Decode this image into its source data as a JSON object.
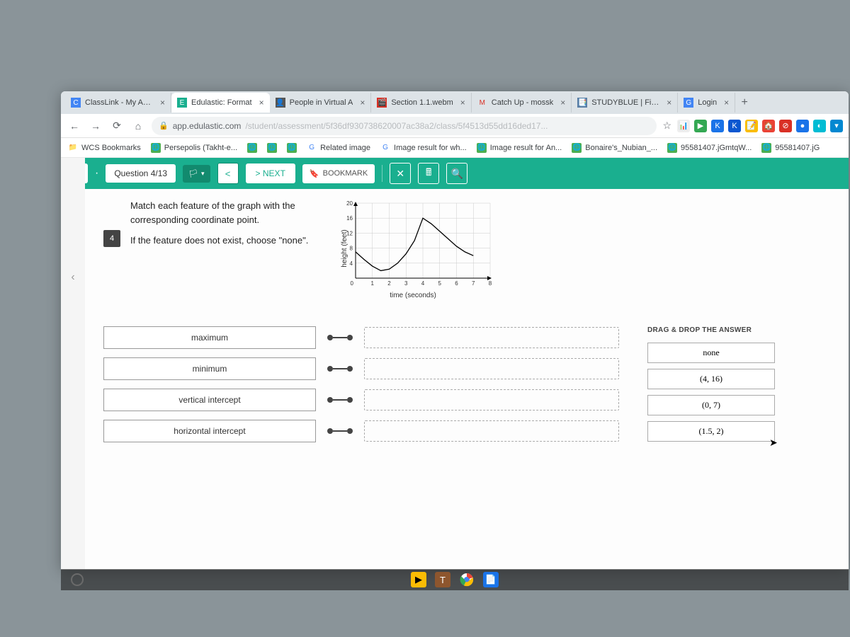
{
  "tabs": [
    {
      "fav_bg": "#4285f4",
      "fav_txt": "C",
      "title": "ClassLink - My Apps"
    },
    {
      "fav_bg": "#1aaf8f",
      "fav_txt": "E",
      "title": "Edulastic: Format"
    },
    {
      "fav_bg": "#555",
      "fav_txt": "👤",
      "title": "People in Virtual A"
    },
    {
      "fav_bg": "#d93025",
      "fav_txt": "🎬",
      "title": "Section 1.1.webm"
    },
    {
      "fav_bg": "#fff",
      "fav_txt": "M",
      "title": "Catch Up - mossk"
    },
    {
      "fav_bg": "#5b7fa6",
      "fav_txt": "📑",
      "title": "STUDYBLUE | Find"
    },
    {
      "fav_bg": "#4285f4",
      "fav_txt": "G",
      "title": "Login"
    }
  ],
  "url_host": "app.edulastic.com",
  "url_path": "/student/assessment/5f36df930738620007ac38a2/class/5f4513d55dd16ded17...",
  "bookmarks": [
    {
      "ic": "📁",
      "txt": "WCS Bookmarks"
    },
    {
      "ic": "🌐",
      "txt": "Persepolis (Takht-e..."
    },
    {
      "ic": "🌐",
      "txt": ""
    },
    {
      "ic": "🌐",
      "txt": ""
    },
    {
      "ic": "🌐",
      "txt": ""
    },
    {
      "ic": "G",
      "txt": "Related image"
    },
    {
      "ic": "G",
      "txt": "Image result for wh..."
    },
    {
      "ic": "🌐",
      "txt": "Image result for An..."
    },
    {
      "ic": "🌐",
      "txt": "Bonaire's_Nubian_..."
    },
    {
      "ic": "🌐",
      "txt": "95581407.jGmtqW..."
    },
    {
      "ic": "🌐",
      "txt": "95581407.jG"
    }
  ],
  "header": {
    "logo": "E",
    "question": "Question 4/13",
    "prev": "<",
    "next": "> NEXT",
    "bookmark": "BOOKMARK"
  },
  "question": {
    "number": "4",
    "p1": "Match each feature of the graph with the corresponding coordinate point.",
    "p2": "If the feature does not exist, choose \"none\"."
  },
  "chart_data": {
    "type": "line",
    "title": "",
    "xlabel": "time (seconds)",
    "ylabel": "height (feet)",
    "xlim": [
      0,
      8
    ],
    "ylim": [
      0,
      20
    ],
    "xticks": [
      1,
      2,
      3,
      4,
      5,
      6,
      7,
      8
    ],
    "yticks": [
      4,
      8,
      12,
      16,
      20
    ],
    "x": [
      0,
      0.5,
      1,
      1.5,
      2,
      2.5,
      3,
      3.5,
      4,
      4.5,
      5,
      5.5,
      6,
      6.5,
      7
    ],
    "y": [
      7,
      5,
      3.2,
      2,
      2.4,
      4,
      6.5,
      10,
      16,
      14.5,
      12.5,
      10.5,
      8.5,
      7,
      6
    ]
  },
  "features": [
    "maximum",
    "minimum",
    "vertical intercept",
    "horizontal intercept"
  ],
  "answers_title": "DRAG & DROP THE ANSWER",
  "answers": [
    "none",
    "(4, 16)",
    "(0, 7)",
    "(1.5, 2)"
  ]
}
